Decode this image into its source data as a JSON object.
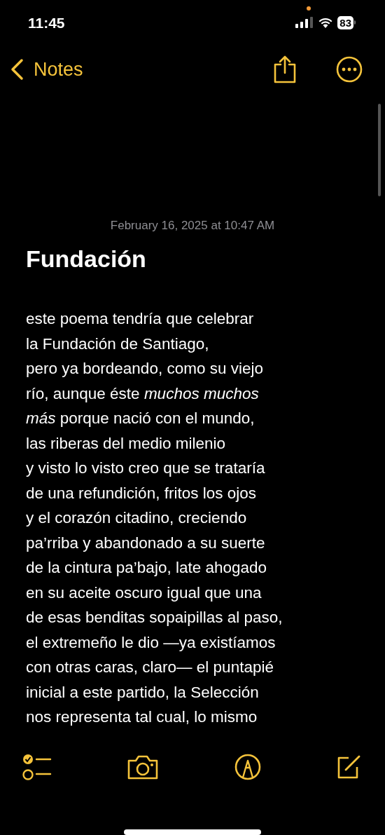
{
  "status_bar": {
    "time": "11:45",
    "battery": "83"
  },
  "nav": {
    "back_label": "Notes"
  },
  "note": {
    "date": "February 16, 2025 at 10:47 AM",
    "title": "Fundación",
    "lines": [
      "este poema tendría que celebrar",
      "la Fundación de Santiago,",
      "pero ya bordeando, como su viejo",
      "río, aunque éste *muchos muchos*",
      "*más* porque nació con el mundo,",
      "las riberas del medio milenio",
      "y visto lo visto creo que se trataría",
      "de una refundición, fritos los ojos",
      "y el corazón citadino, creciendo",
      "pa’rriba y abandonado a su suerte",
      "de la cintura pa’bajo, late ahogado",
      "en su aceite oscuro igual que una",
      "de esas benditas sopaipillas al paso,",
      "el extremeño le dio —ya existíamos",
      "con otras caras, claro— el puntapié",
      "inicial a este partido, la Selección",
      "nos representa tal cual, lo mismo"
    ]
  }
}
